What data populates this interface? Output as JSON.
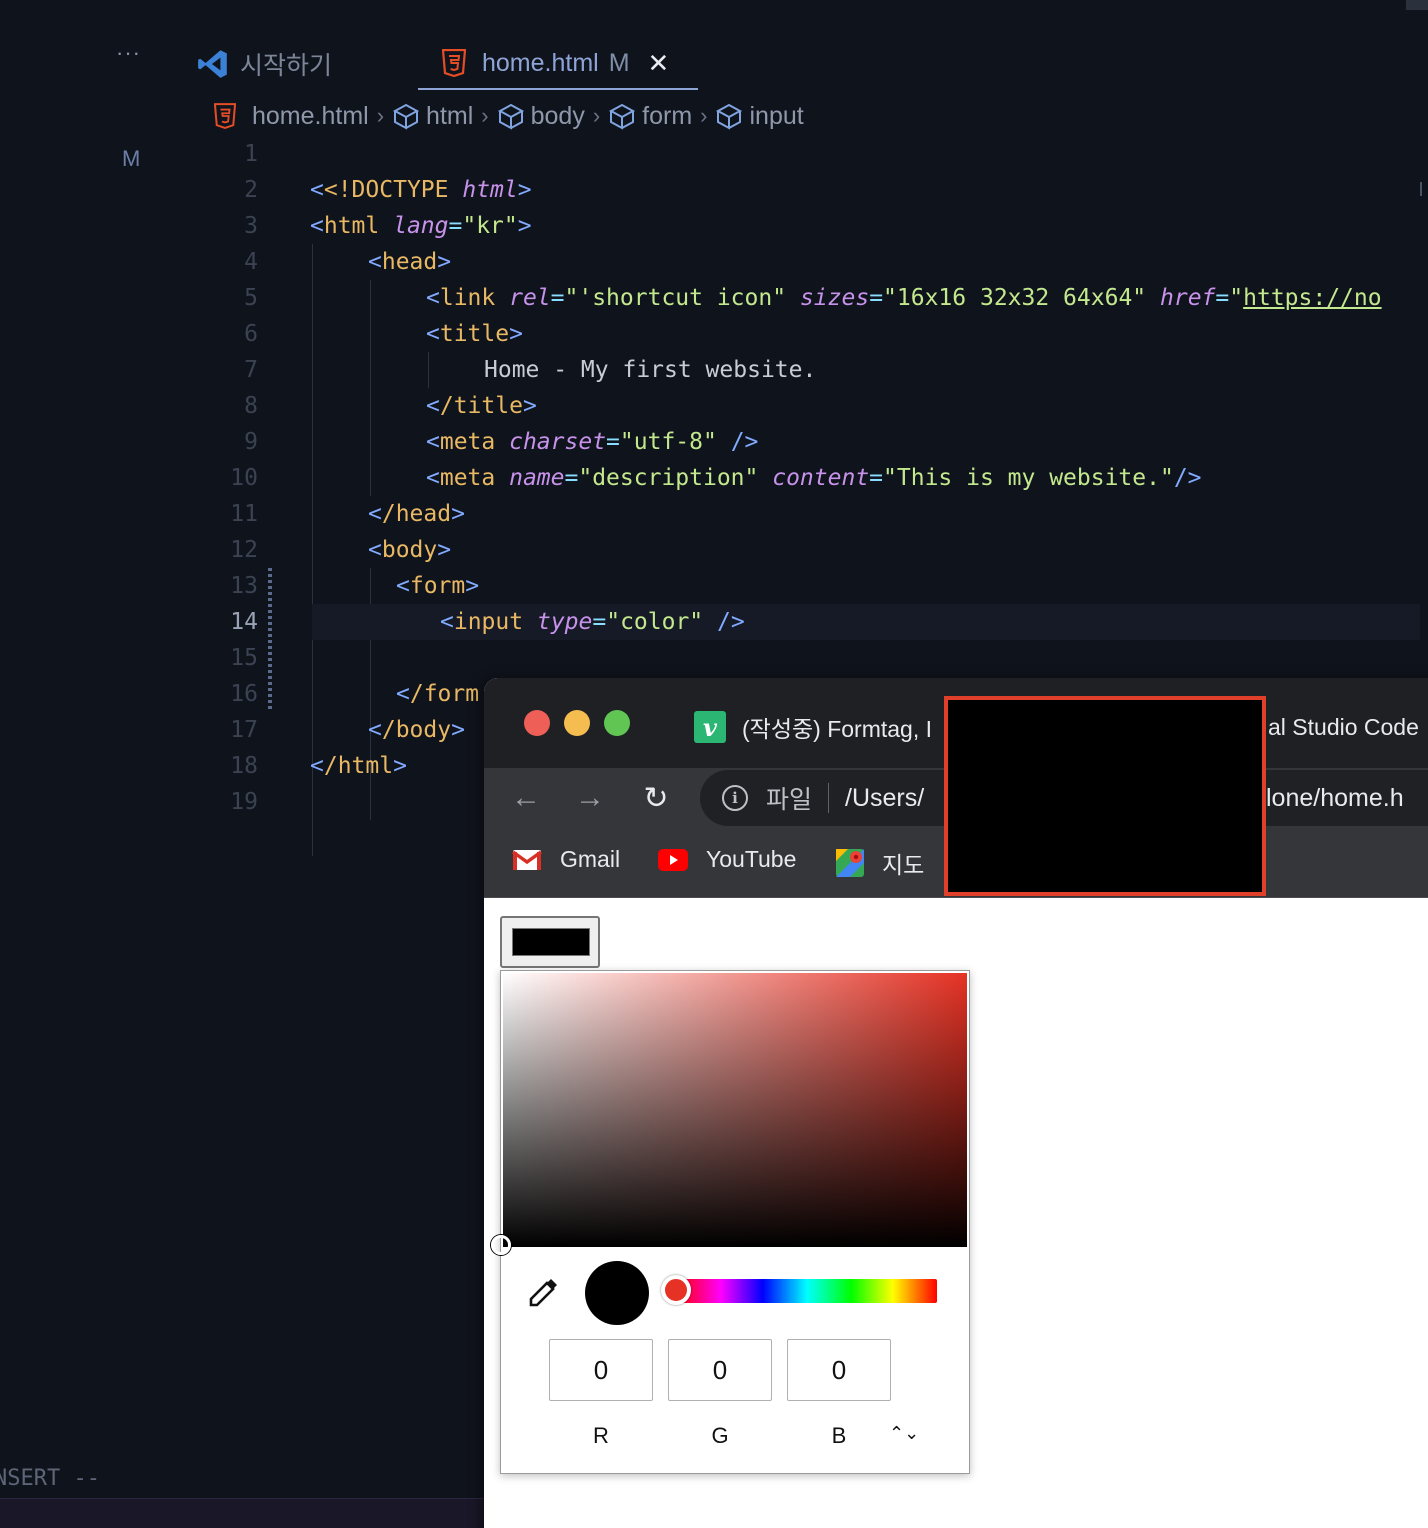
{
  "editor": {
    "more_label": "···",
    "tabs": [
      {
        "label": "시작하기",
        "icon": "vscode-icon",
        "active": false
      },
      {
        "label": "home.html",
        "icon": "html5-icon",
        "active": true,
        "modified": "M",
        "close": "✕"
      }
    ],
    "breadcrumb": [
      "home.html",
      "html",
      "body",
      "form",
      "input"
    ],
    "gutter_marker": "M",
    "current_line": 14,
    "lines": [
      {
        "n": "1"
      },
      {
        "n": "2"
      },
      {
        "n": "3"
      },
      {
        "n": "4"
      },
      {
        "n": "5"
      },
      {
        "n": "6"
      },
      {
        "n": "7"
      },
      {
        "n": "8"
      },
      {
        "n": "9"
      },
      {
        "n": "10"
      },
      {
        "n": "11"
      },
      {
        "n": "12"
      },
      {
        "n": "13"
      },
      {
        "n": "14"
      },
      {
        "n": "15"
      },
      {
        "n": "16"
      },
      {
        "n": "17"
      },
      {
        "n": "18"
      },
      {
        "n": "19"
      }
    ],
    "code": {
      "l2_doctype": "<!DOCTYPE",
      "l2_html": "html",
      "l3_tag": "html",
      "l3_attr": "lang",
      "l3_val": "\"kr\"",
      "l4_tag": "head",
      "l5_tag": "link",
      "l5_rel": "rel",
      "l5_rel_val": "\"'shortcut icon\"",
      "l5_sizes": "sizes",
      "l5_sizes_val": "\"16x16 32x32 64x64\"",
      "l5_href": "href",
      "l5_href_val": "https://no",
      "l6_tag": "title",
      "l7_text": "Home - My first website.",
      "l8_tag": "/title",
      "l9_tag": "meta",
      "l9_attr": "charset",
      "l9_val": "\"utf-8\"",
      "l10_tag": "meta",
      "l10_name": "name",
      "l10_name_val": "\"description\"",
      "l10_content": "content",
      "l10_content_val": "\"This is my website.\"",
      "l11_tag": "/head",
      "l12_tag": "body",
      "l13_tag": "form",
      "l14_tag": "input",
      "l14_attr": "type",
      "l14_val": "\"color\"",
      "l16_tag": "/form",
      "l17_tag": "/body",
      "l18_tag": "/html"
    },
    "mode_label": "NSERT --"
  },
  "browser": {
    "tab_title_left": "(작성중) Formtag, I",
    "tab_title_right": "al Studio Code",
    "nav": {
      "back": "←",
      "forward": "→",
      "reload": "↻"
    },
    "omnibox": {
      "info": "i",
      "scheme": "파일",
      "path_left": "/Users/",
      "path_right": "lone/home.h"
    },
    "bookmarks": [
      {
        "label": "Gmail",
        "icon": "gmail-icon"
      },
      {
        "label": "YouTube",
        "icon": "youtube-icon"
      },
      {
        "label": "지도",
        "icon": "maps-icon"
      }
    ],
    "color_input": {
      "value": "#000000"
    },
    "picker": {
      "hue_color": "#e53224",
      "r": "0",
      "g": "0",
      "b": "0",
      "labels": {
        "r": "R",
        "g": "G",
        "b": "B"
      },
      "format_toggle": "⌃⌄"
    }
  },
  "colors": {
    "accent_tab": "#8fa4d6",
    "redaction_border": "#e0402a",
    "editor_bg": "#0f131c"
  }
}
